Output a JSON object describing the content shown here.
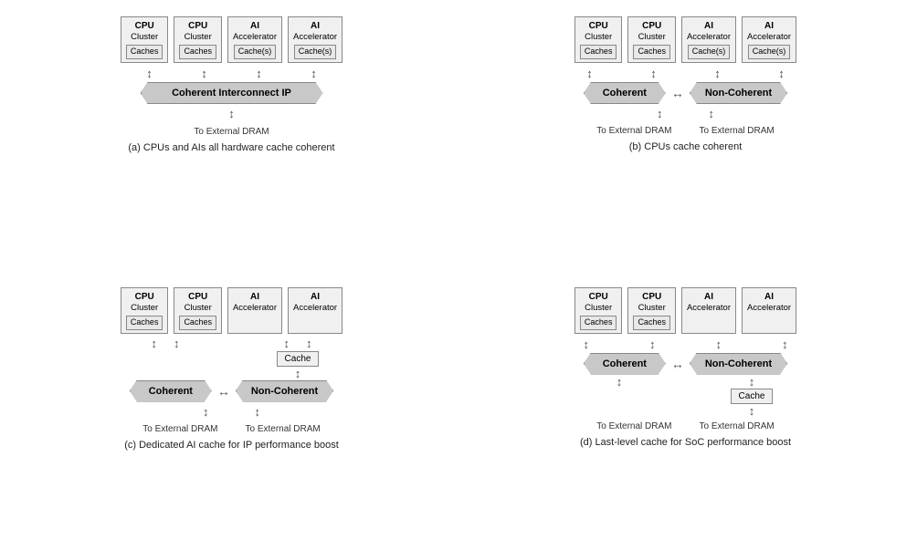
{
  "diagrams": [
    {
      "id": "a",
      "caption": "(a) CPUs and AIs all hardware cache coherent",
      "nodes": [
        {
          "top": "CPU",
          "sub": "Cluster",
          "cache": "Caches"
        },
        {
          "top": "CPU",
          "sub": "Cluster",
          "cache": "Caches"
        },
        {
          "top": "AI",
          "sub": "Accelerator",
          "cache": "Cache(s)"
        },
        {
          "top": "AI",
          "sub": "Accelerator",
          "cache": "Cache(s)"
        }
      ],
      "interconnect": "Coherent Interconnect IP",
      "type": "single",
      "dram": [
        "To External DRAM"
      ]
    },
    {
      "id": "b",
      "caption": "(b) CPUs cache coherent",
      "nodes": [
        {
          "top": "CPU",
          "sub": "Cluster",
          "cache": "Caches"
        },
        {
          "top": "CPU",
          "sub": "Cluster",
          "cache": "Caches"
        },
        {
          "top": "AI",
          "sub": "Accelerator",
          "cache": "Cache(s)"
        },
        {
          "top": "AI",
          "sub": "Accelerator",
          "cache": "Cache(s)"
        }
      ],
      "type": "dual",
      "banner_left": "Coherent",
      "banner_right": "Non-Coherent",
      "dram": [
        "To External DRAM",
        "To External DRAM"
      ]
    },
    {
      "id": "c",
      "caption": "(c) Dedicated AI cache for IP performance boost",
      "nodes": [
        {
          "top": "CPU",
          "sub": "Cluster",
          "cache": "Caches"
        },
        {
          "top": "CPU",
          "sub": "Cluster",
          "cache": "Caches"
        },
        {
          "top": "AI",
          "sub": "Accelerator",
          "cache": ""
        },
        {
          "top": "AI",
          "sub": "Accelerator",
          "cache": ""
        }
      ],
      "type": "dual-cache",
      "banner_left": "Coherent",
      "banner_right": "Non-Coherent",
      "cache_mid": "Cache",
      "dram": [
        "To External DRAM",
        "To External DRAM"
      ]
    },
    {
      "id": "d",
      "caption": "(d) Last-level cache for SoC performance boost",
      "nodes": [
        {
          "top": "CPU",
          "sub": "Cluster",
          "cache": "Caches"
        },
        {
          "top": "CPU",
          "sub": "Cluster",
          "cache": "Caches"
        },
        {
          "top": "AI",
          "sub": "Accelerator",
          "cache": ""
        },
        {
          "top": "AI",
          "sub": "Accelerator",
          "cache": ""
        }
      ],
      "type": "dual-cache-bottom",
      "banner_left": "Coherent",
      "banner_right": "Non-Coherent",
      "cache_mid": "Cache",
      "dram": [
        "To External DRAM",
        "To External DRAM"
      ]
    }
  ]
}
